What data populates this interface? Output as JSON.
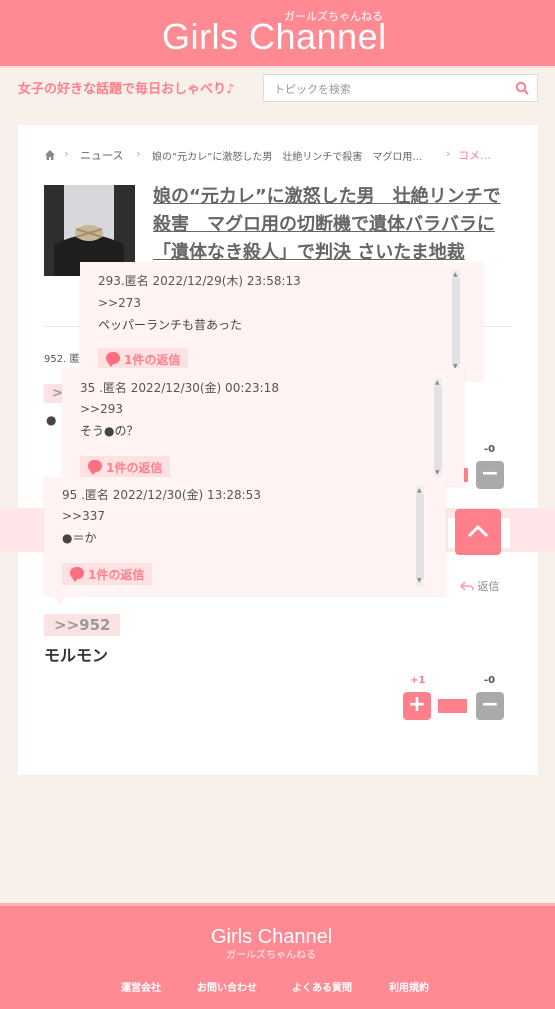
{
  "header": {
    "logo": "Girls Channel",
    "logo_sub": "ガールズちゃんねる"
  },
  "subbar": {
    "tagline": "女子の好きな話題で毎日おしゃべり♪",
    "search_placeholder": "トピックを検索"
  },
  "breadcrumb": {
    "news": "ニュース",
    "topic": "娘の“元カレ”に激怒した男　壮絶リンチで殺害　マグロ用…",
    "current": "コメ…"
  },
  "article": {
    "title_line1": "娘の“元カレ”に激怒した男　壮絶リンチで",
    "title_line2": "殺害　マグロ用の切断機で遺体バラバラに",
    "title_line3": "「遺体なき殺人」で判決 さいたま地裁"
  },
  "popups": [
    {
      "head": "293.匿名 2022/12/29(木) 23:58:13",
      "ref": ">>273",
      "body": "ペッパーランチも昔あった",
      "replies": "1件の返信"
    },
    {
      "head": "35  .匿名 2022/12/30(金) 00:23:18",
      "ref": ">>293",
      "body": "そう●の？",
      "replies": "1件の返信"
    },
    {
      "head": "95 .匿名 2022/12/30(金) 13:28:53",
      "ref": ">>337",
      "body": "●＝か",
      "replies": "1件の返信"
    }
  ],
  "comment": {
    "num": "952. 匿",
    "partial_tag": ">>",
    "partial_text": "●",
    "ref_tag": ">>952",
    "text": "モルモン",
    "reply": "返信",
    "minus_count_top": "-0",
    "plus_count": "+1",
    "minus_count": "-0"
  },
  "footer": {
    "logo": "Girls Channel",
    "logo_sub": "ガールズちゃんねる",
    "links": [
      "運営会社",
      "お問い合わせ",
      "よくある質問",
      "利用規約"
    ]
  },
  "colors": {
    "brand": "#ff8a94",
    "accent": "#ff7f8b"
  }
}
